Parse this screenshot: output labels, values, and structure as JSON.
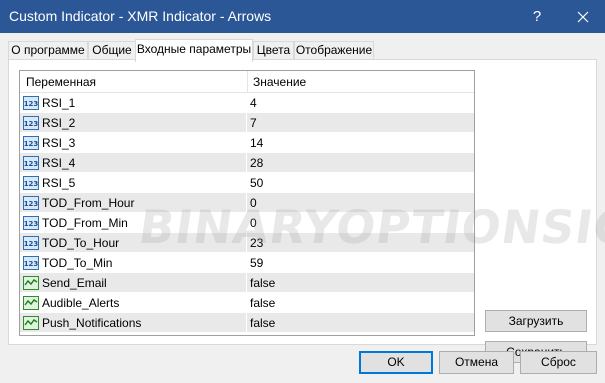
{
  "window": {
    "title": "Custom Indicator - XMR Indicator - Arrows",
    "help_glyph": "?"
  },
  "tabs": [
    {
      "label": "О программе",
      "active": false
    },
    {
      "label": "Общие",
      "active": false
    },
    {
      "label": "Входные параметры",
      "active": true
    },
    {
      "label": "Цвета",
      "active": false
    },
    {
      "label": "Отображение",
      "active": false
    }
  ],
  "grid": {
    "headers": {
      "variable": "Переменная",
      "value": "Значение"
    },
    "rows": [
      {
        "icon": "integer-icon",
        "name": "RSI_1",
        "value": "4"
      },
      {
        "icon": "integer-icon",
        "name": "RSI_2",
        "value": "7"
      },
      {
        "icon": "integer-icon",
        "name": "RSI_3",
        "value": "14"
      },
      {
        "icon": "integer-icon",
        "name": "RSI_4",
        "value": "28"
      },
      {
        "icon": "integer-icon",
        "name": "RSI_5",
        "value": "50"
      },
      {
        "icon": "integer-icon",
        "name": "TOD_From_Hour",
        "value": "0"
      },
      {
        "icon": "integer-icon",
        "name": "TOD_From_Min",
        "value": "0"
      },
      {
        "icon": "integer-icon",
        "name": "TOD_To_Hour",
        "value": "23"
      },
      {
        "icon": "integer-icon",
        "name": "TOD_To_Min",
        "value": "59"
      },
      {
        "icon": "boolean-icon",
        "name": "Send_Email",
        "value": "false"
      },
      {
        "icon": "boolean-icon",
        "name": "Audible_Alerts",
        "value": "false"
      },
      {
        "icon": "boolean-icon",
        "name": "Push_Notifications",
        "value": "false"
      }
    ]
  },
  "side_buttons": {
    "load": "Загрузить",
    "save": "Сохранить"
  },
  "bottom_buttons": {
    "ok": "OK",
    "cancel": "Отмена",
    "reset": "Сброс"
  },
  "watermark": "BINARYOPTIONSIGNALS.COM",
  "colors": {
    "titlebar": "#2b5797",
    "alt_row": "#e9e9e9",
    "default_button_border": "#0078d7"
  }
}
